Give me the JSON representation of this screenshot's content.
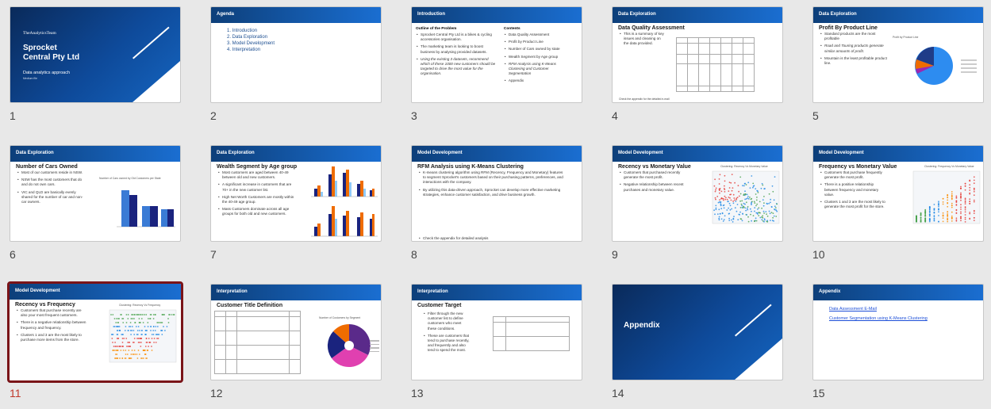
{
  "slides": [
    {
      "n": "1",
      "kind": "cover",
      "brand": "TheAnalyticsTeam",
      "title_line1": "Sprocket",
      "title_line2": "Central Pty Ltd",
      "subtitle": "Data analytics approach",
      "subtitle2": "Medium file"
    },
    {
      "n": "2",
      "kind": "agenda",
      "header": "Agenda",
      "items": [
        "1.  Introduction",
        "2.  Data Exploration",
        "3.  Model Development",
        "4.  Interpretation"
      ]
    },
    {
      "n": "3",
      "kind": "intro",
      "header": "Introduction",
      "left_title": "Outline of the Problem",
      "left_items": [
        "Sprocket Central Pty Ltd is a bikes & cycling accessories organisation.",
        "The marketing team is looking to boost business by analysing provided datasets.",
        "Using the existing 3 datasets, recommend which of these 1000 new customers should be targeted to drive the most value for the organisation."
      ],
      "right_title": "Contents",
      "right_items": [
        "Data Quality Assessment",
        "Profit by Product Line",
        "Number of Cars owned by state",
        "Wealth Segment by Age group",
        "RFM Analysis using K-Means Clustering and Customer Segmentation",
        "Appendix"
      ]
    },
    {
      "n": "4",
      "kind": "dq",
      "header": "Data Exploration",
      "title": "Data Quality Assessment",
      "items": [
        "This is a summary of key issues and cleaning on the data provided."
      ],
      "footer": "Check the appendix for the detailed e-mail"
    },
    {
      "n": "5",
      "kind": "pie",
      "header": "Data Exploration",
      "title": "Profit By Product Line",
      "items": [
        "Standard products are the most profitable",
        "Road and Touring products generate similar amounts of profit.",
        "Mountain is the least profitable product line."
      ],
      "chart_title": "Profit by Product Line"
    },
    {
      "n": "6",
      "kind": "bars",
      "header": "Data Exploration",
      "title": "Number of Cars Owned",
      "items": [
        "Most of our customers reside in NSW.",
        "NSW has the most customers that do and do not own cars.",
        "VIC and QLD are basically evenly shared for the number of car and non-car owners."
      ],
      "chart_title": "Number of Cars owned by Old Customers per State"
    },
    {
      "n": "7",
      "kind": "wealth",
      "header": "Data Exploration",
      "title": "Wealth Segment by Age group",
      "items": [
        "Most customers are aged between 40-49 between old and new customers.",
        "A significant increase in customers that are 70+ in the new customer list.",
        "High Net Worth Customers are mostly within the 40-49 age group.",
        "Mass Customers dominate across all age groups for both old and new customers."
      ]
    },
    {
      "n": "8",
      "kind": "text",
      "header": "Model Development",
      "title": "RFM Analysis using K-Means Clustering",
      "items": [
        "K-means clustering algorithm using RFM (Recency, Frequency and Monetary) features to segment Sprocket's customers based on their purchasing patterns, preferences, and interactions with the company.",
        "By utilizing this data-driven approach, Sprocket can develop more effective marketing strategies, enhance customer satisfaction, and drive business growth."
      ],
      "footer": "Check the appendix for detailed analysis"
    },
    {
      "n": "9",
      "kind": "scatter",
      "header": "Model Development",
      "title": "Recency vs Monetary Value",
      "items": [
        "Customers that purchased recently generate the most profit.",
        "Negative relationship between recent purchases and monetary value."
      ],
      "chart_title": "Clustering: Recency Vs Monetary Value"
    },
    {
      "n": "10",
      "kind": "scatter2",
      "header": "Model Development",
      "title": "Frequency vs Monetary Value",
      "items": [
        "Customers that purchase frequently generate the most profit.",
        "There is a positive relationship between frequency and monetary value.",
        "Clusters 1 and 3 are the most likely to generate the most profit for the store."
      ],
      "chart_title": "Clustering: Frequency Vs Monetary Value"
    },
    {
      "n": "11",
      "kind": "scatter3",
      "header": "Model Development",
      "title": "Recency vs Frequency",
      "items": [
        "Customers that purchase recently are also your most frequent customers.",
        "There is a negative relationship between frequency and frequency.",
        "Clusters 1 and 3 are the most likely to purchase more items from the store."
      ],
      "chart_title": "Clustering: Recency Vs Frequency"
    },
    {
      "n": "12",
      "kind": "donut",
      "header": "Interpretation",
      "title": "Customer Title Definition",
      "chart_title": "Number of Customers by Segment"
    },
    {
      "n": "13",
      "kind": "target",
      "header": "Interpretation",
      "title": "Customer Target",
      "items": [
        "Filter through the new customer list to define customers who meet these conditions.",
        "These are customers that tend to purchase recently, and frequently and also tend to spend the most."
      ]
    },
    {
      "n": "14",
      "kind": "section",
      "title": "Appendix"
    },
    {
      "n": "15",
      "kind": "appendix",
      "header": "Appendix",
      "links": [
        "Data Assessment E-Mail",
        "Customer Segmentation using K-Means Clustering"
      ]
    }
  ],
  "selected_slide": "11",
  "colors": {
    "header_dark": "#0d3f7a",
    "header_light": "#1a6ed1",
    "selection": "#7a1418",
    "link": "#1d4fd8"
  }
}
